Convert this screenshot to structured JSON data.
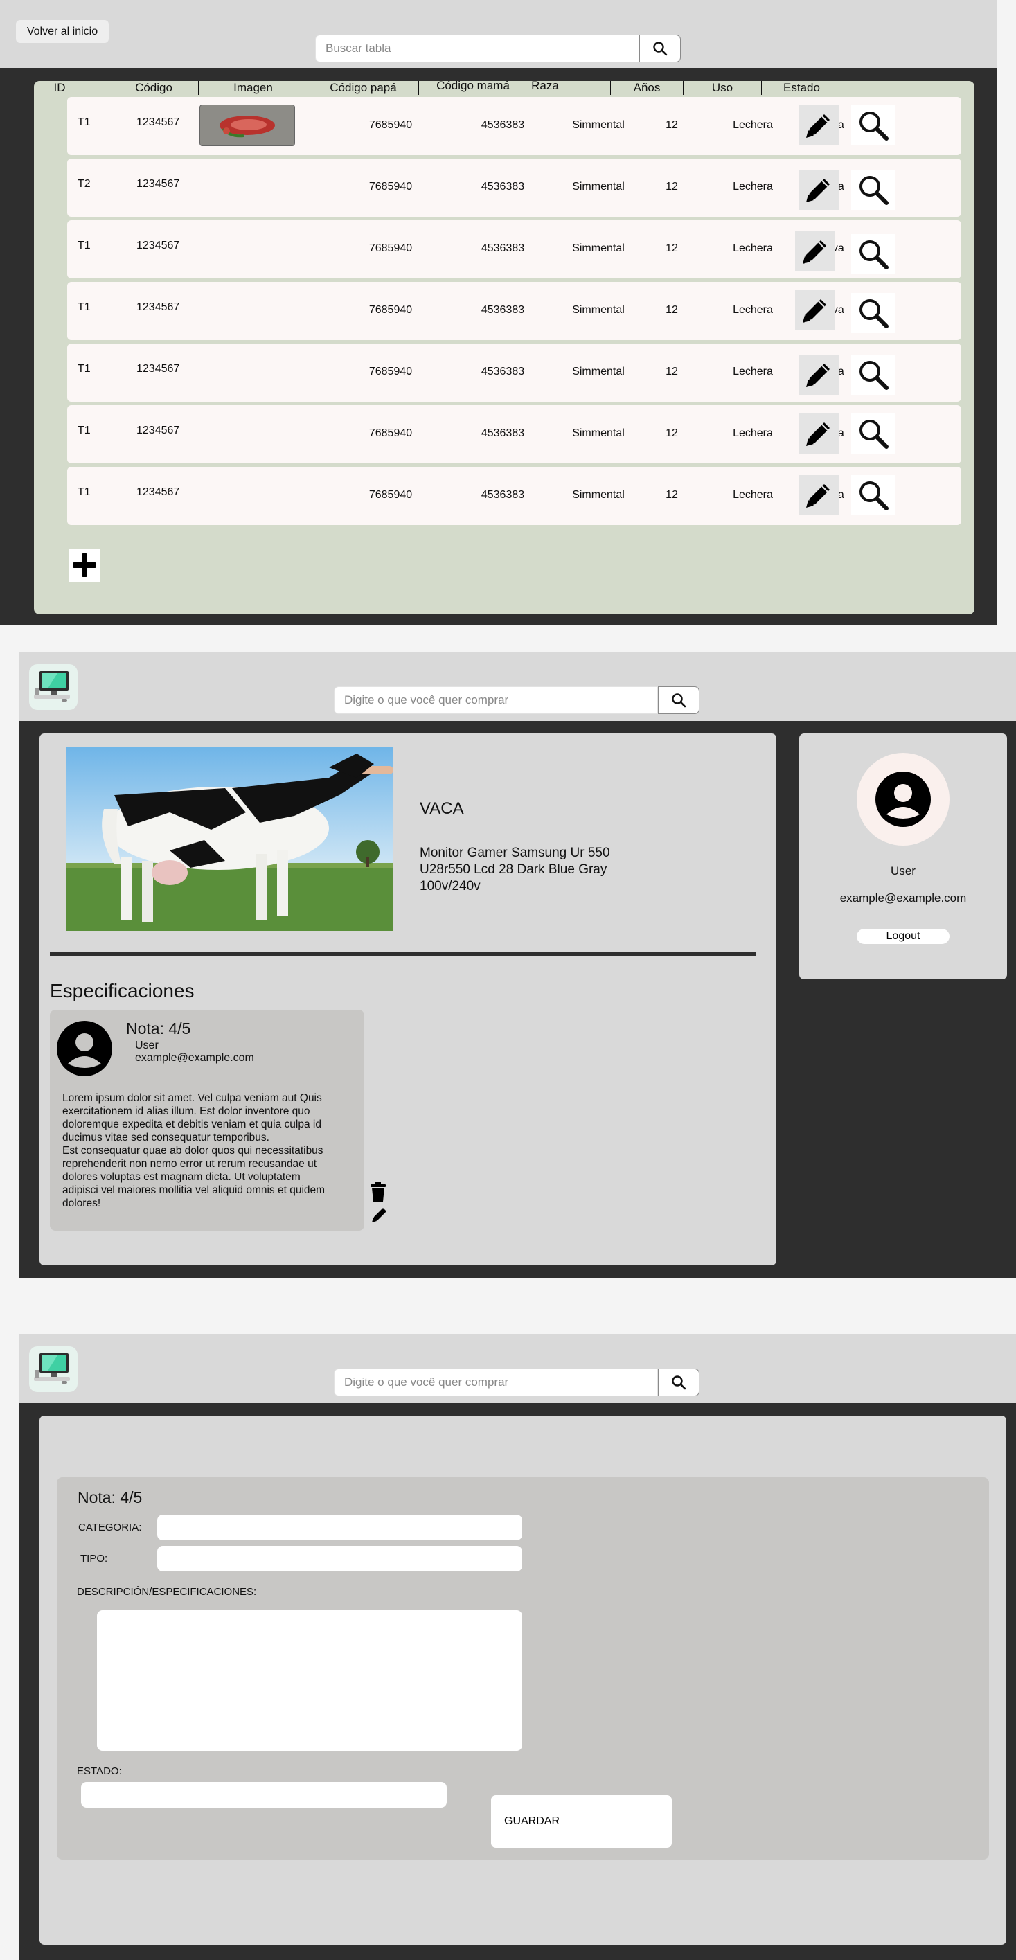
{
  "list_page": {
    "back_label": "Volver al inicio",
    "search": {
      "placeholder": "Buscar tabla"
    },
    "columns": [
      "ID",
      "Código",
      "Imagen",
      "Código papá",
      "Código mamá",
      "Raza",
      "Años",
      "Uso",
      "Estado"
    ],
    "rows": [
      {
        "id": "T1",
        "codigo": "1234567",
        "has_image": true,
        "papa": "7685940",
        "mama": "4536383",
        "raza": "Simmental",
        "anos": "12",
        "uso": "Lechera",
        "estado": "Activa"
      },
      {
        "id": "T2",
        "codigo": "1234567",
        "has_image": false,
        "papa": "7685940",
        "mama": "4536383",
        "raza": "Simmental",
        "anos": "12",
        "uso": "Lechera",
        "estado": "Activa"
      },
      {
        "id": "T1",
        "codigo": "1234567",
        "has_image": false,
        "papa": "7685940",
        "mama": "4536383",
        "raza": "Simmental",
        "anos": "12",
        "uso": "Lechera",
        "estado": "Activa"
      },
      {
        "id": "T1",
        "codigo": "1234567",
        "has_image": false,
        "papa": "7685940",
        "mama": "4536383",
        "raza": "Simmental",
        "anos": "12",
        "uso": "Lechera",
        "estado": "Activa"
      },
      {
        "id": "T1",
        "codigo": "1234567",
        "has_image": false,
        "papa": "7685940",
        "mama": "4536383",
        "raza": "Simmental",
        "anos": "12",
        "uso": "Lechera",
        "estado": "Activa"
      },
      {
        "id": "T1",
        "codigo": "1234567",
        "has_image": false,
        "papa": "7685940",
        "mama": "4536383",
        "raza": "Simmental",
        "anos": "12",
        "uso": "Lechera",
        "estado": "Activa"
      },
      {
        "id": "T1",
        "codigo": "1234567",
        "has_image": false,
        "papa": "7685940",
        "mama": "4536383",
        "raza": "Simmental",
        "anos": "12",
        "uso": "Lechera",
        "estado": "Activa"
      }
    ],
    "icons": {
      "edit": "pencil-icon",
      "view": "magnifier-icon",
      "add": "plus-icon"
    }
  },
  "detail_page": {
    "search": {
      "placeholder": "Digite o que você quer comprar"
    },
    "product": {
      "title": "VACA",
      "desc_line1": "Monitor Gamer Samsung Ur 550",
      "desc_line2": "U28r550 Lcd 28 Dark Blue Gray",
      "desc_line3": "100v/240v"
    },
    "specs_heading": "Especificaciones",
    "review": {
      "rating": "Nota: 4/5",
      "user": "User",
      "email": "example@example.com",
      "body_lines": [
        "Lorem ipsum dolor sit amet. Vel culpa veniam aut Quis",
        "exercitationem id alias illum. Est dolor inventore quo",
        "doloremque expedita et debitis veniam et quia culpa id",
        "ducimus vitae sed consequatur temporibus.",
        "Est consequatur quae ab dolor quos qui necessitatibus",
        "reprehenderit non nemo error ut rerum recusandae ut",
        "dolores voluptas est magnam dicta. Ut voluptatem",
        "adipisci vel maiores mollitia vel aliquid omnis et quidem",
        "dolores!"
      ]
    },
    "sidebar": {
      "user": "User",
      "email": "example@example.com",
      "logout": "Logout"
    }
  },
  "form_page": {
    "search": {
      "placeholder": "Digite o que você quer comprar"
    },
    "rating": "Nota: 4/5",
    "categoria_label": "CATEGORIA:",
    "tipo_label": "TIPO:",
    "descripcion_label": "DESCRIPCIÓN/ESPECIFICACIONES:",
    "estado_label": "ESTADO:",
    "save_label": "GUARDAR"
  },
  "colors": {
    "dark_bg": "#2e2e2e",
    "header_bg": "#d9d9d9",
    "table_panel": "#d4dbcb",
    "row_bg": "#fcf7f6",
    "card_bg": "#c8c7c5"
  }
}
